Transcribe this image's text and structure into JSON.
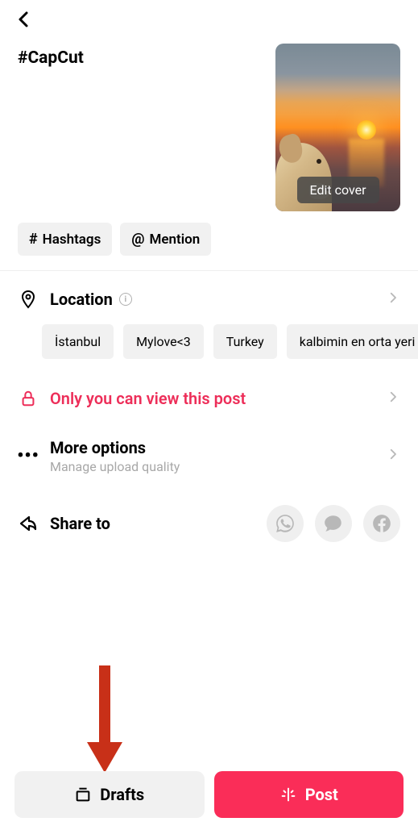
{
  "caption": "#CapCut",
  "cover": {
    "edit_label": "Edit cover"
  },
  "chips": {
    "hashtags_label": "Hashtags",
    "mention_label": "Mention"
  },
  "location": {
    "title": "Location",
    "suggestions": [
      "İstanbul",
      "Mylove<3",
      "Turkey",
      "kalbimin en orta yeri"
    ]
  },
  "privacy": {
    "title": "Only you can view this post"
  },
  "more": {
    "title": "More options",
    "subtitle": "Manage upload quality"
  },
  "share": {
    "title": "Share to"
  },
  "buttons": {
    "drafts": "Drafts",
    "post": "Post"
  }
}
